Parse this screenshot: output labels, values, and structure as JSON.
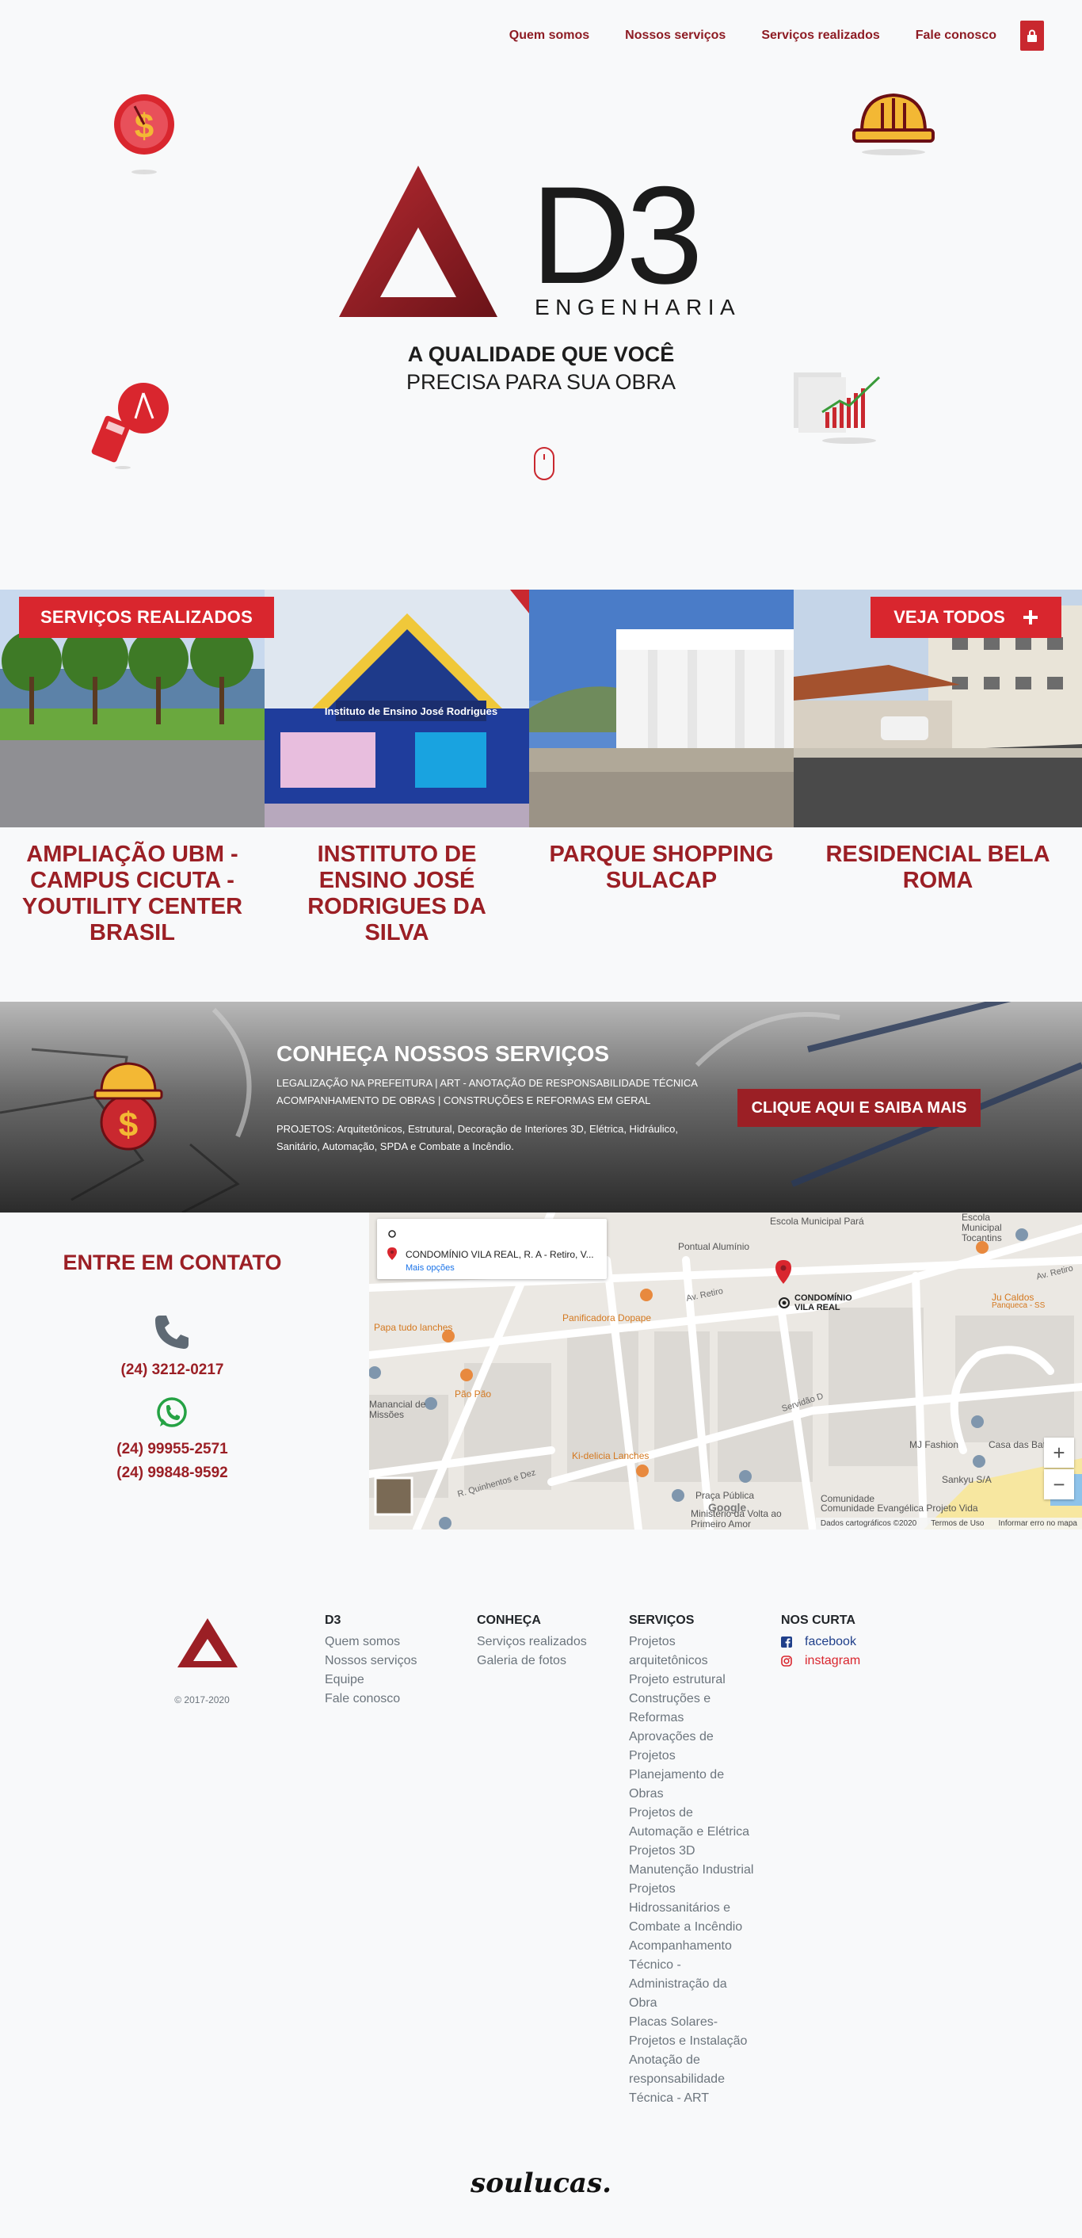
{
  "nav": {
    "items": [
      "Quem somos",
      "Nossos serviços",
      "Serviços realizados",
      "Fale conosco"
    ]
  },
  "hero": {
    "logo_text": "D3",
    "logo_sub": "ENGENHARIA",
    "tagline_bold": "A QUALIDADE QUE VOCÊ",
    "tagline_regular": "PRECISA PARA SUA OBRA"
  },
  "services": {
    "badge_left": "SERVIÇOS REALIZADOS",
    "badge_right": "VEJA TODOS",
    "items": [
      {
        "title": "AMPLIAÇÃO UBM - CAMPUS CICUTA - YOUTILITY CENTER BRASIL"
      },
      {
        "title": "INSTITUTO DE ENSINO JOSÉ RODRIGUES DA SILVA",
        "sign": "Instituto de Ensino José Rodrigues"
      },
      {
        "title": "PARQUE SHOPPING SULACAP"
      },
      {
        "title": "RESIDENCIAL BELA ROMA"
      }
    ]
  },
  "banner": {
    "title": "CONHEÇA NOSSOS SERVIÇOS",
    "line1": "LEGALIZAÇÃO NA PREFEITURA | ART - ANOTAÇÃO DE RESPONSABILIDADE TÉCNICA",
    "line2": "ACOMPANHAMENTO DE OBRAS | CONSTRUÇÕES E REFORMAS EM GERAL",
    "line3": "PROJETOS: Arquitetônicos, Estrutural, Decoração de Interiores 3D, Elétrica, Hidráulico,",
    "line4": "Sanitário, Automação, SPDA e Combate a Incêndio.",
    "button": "CLIQUE AQUI E SAIBA MAIS"
  },
  "contact": {
    "title": "ENTRE EM CONTATO",
    "phone": "(24) 3212-0217",
    "whatsapp1": "(24) 99955-2571",
    "whatsapp2": "(24) 99848-9592"
  },
  "map": {
    "address": "CONDOMÍNIO VILA REAL, R. A - Retiro, V...",
    "more_options": "Mais opções",
    "pin_label_1": "CONDOMÍNIO",
    "pin_label_2": "VILA REAL",
    "labels": {
      "padaria": "Panificadora Dopape",
      "papa": "Papa tudo lanches",
      "paopao": "Pão Pão",
      "kidelicia": "Ki-delicia Lanches",
      "praca": "Praça Pública",
      "escola": "Escola Municipal Pará",
      "escola2": "Escola Municipal Tocantins",
      "pontual": "Pontual Alumínio",
      "ju": "Ju Caldos",
      "ju2": "Panqueca - SS",
      "mj": "MJ Fashion",
      "casa": "Casa das Baterias",
      "sankyu": "Sankyu S/A",
      "comunidade": "Comunidade Evangélica Projeto Vida",
      "comunidade2": "Comunidade",
      "ministerio": "Ministério da Volta ao Primeiro Amor",
      "missoes": "Manancial de Missões",
      "retiro": "Av. Retiro",
      "retiro2": "Av. Retiro",
      "quinhentos": "R. Quinhentos e Dez",
      "servidao": "Servidão D",
      "google": "Google"
    },
    "footer_data": "Dados cartográficos ©2020",
    "footer_terms": "Termos de Uso",
    "footer_report": "Informar erro no mapa",
    "zoom_in": "+",
    "zoom_out": "−"
  },
  "footer": {
    "copyright": "© 2017-2020",
    "col_d3": {
      "head": "D3",
      "items": [
        "Quem somos",
        "Nossos serviços",
        "Equipe",
        "Fale conosco"
      ]
    },
    "col_conheca": {
      "head": "CONHEÇA",
      "items": [
        "Serviços realizados",
        "Galeria de fotos"
      ]
    },
    "col_servicos": {
      "head": "SERVIÇOS",
      "lines": [
        "Projetos",
        "arquitetônicos",
        "Projeto estrutural",
        "Construções e",
        "Reformas",
        "Aprovações de",
        "Projetos",
        "Planejamento de",
        "Obras",
        "Projetos de",
        "Automação e Elétrica",
        "Projetos 3D",
        "Manutenção Industrial",
        "Projetos",
        "Hidrossanitários e",
        "Combate a Incêndio",
        "Acompanhamento",
        "Técnico -",
        "Administração da",
        "Obra",
        "Placas Solares-",
        "Projetos e Instalação",
        "Anotação de",
        "responsabilidade",
        "Técnica - ART"
      ]
    },
    "col_social": {
      "head": "NOS CURTA",
      "facebook": "facebook",
      "instagram": "instagram"
    },
    "signature": "soulucas."
  },
  "colors": {
    "brand_red": "#c9282f",
    "dark_red": "#9b1f25"
  }
}
